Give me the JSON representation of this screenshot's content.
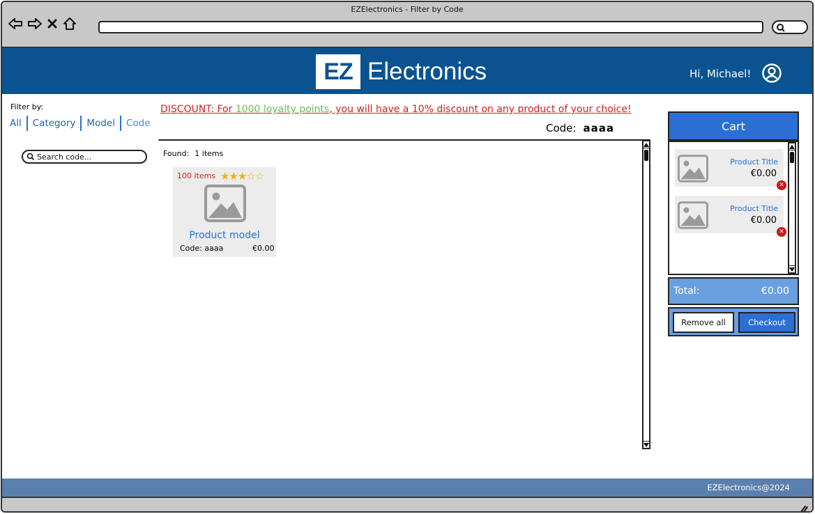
{
  "window": {
    "title": "EZElectronics - Filter by Code"
  },
  "header": {
    "logo_mark": "EZ",
    "logo_text": "Electronics",
    "greeting": "Hi, Michael!"
  },
  "filter": {
    "label": "Filter by:",
    "options": [
      "All",
      "Category",
      "Model",
      "Code"
    ],
    "active": "Code",
    "search_placeholder": "Search code..."
  },
  "discount": {
    "prefix": "DISCOUNT:  For ",
    "points": "1000 loyalty points",
    "suffix": ", you will have a 10% discount on any product of your choice!"
  },
  "code_filter": {
    "label": "Code:",
    "value": "aaaa"
  },
  "results": {
    "found_label": "Found:",
    "found_count": "1 items",
    "products": [
      {
        "quantity": "100 items",
        "rating": 3,
        "rating_max": 5,
        "model": "Product model",
        "code": "Code: aaaa",
        "price": "€0.00"
      }
    ]
  },
  "cart": {
    "title": "Cart",
    "items": [
      {
        "title": "Product Title",
        "price": "€0.00"
      },
      {
        "title": "Product Title",
        "price": "€0.00"
      }
    ],
    "total_label": "Total:",
    "total_value": "€0.00",
    "remove_all_label": "Remove all",
    "checkout_label": "Checkout"
  },
  "footer": {
    "copyright": "EZElectronics@2024"
  },
  "colors": {
    "header_bg": "#0a5390",
    "accent_blue": "#2b6fd4",
    "cart_total_bg": "#6a9fe0",
    "footer_bg": "#5b7fae",
    "discount_red": "#d21f1f",
    "points_green": "#6cbb56",
    "star_gold": "#f2b400"
  }
}
